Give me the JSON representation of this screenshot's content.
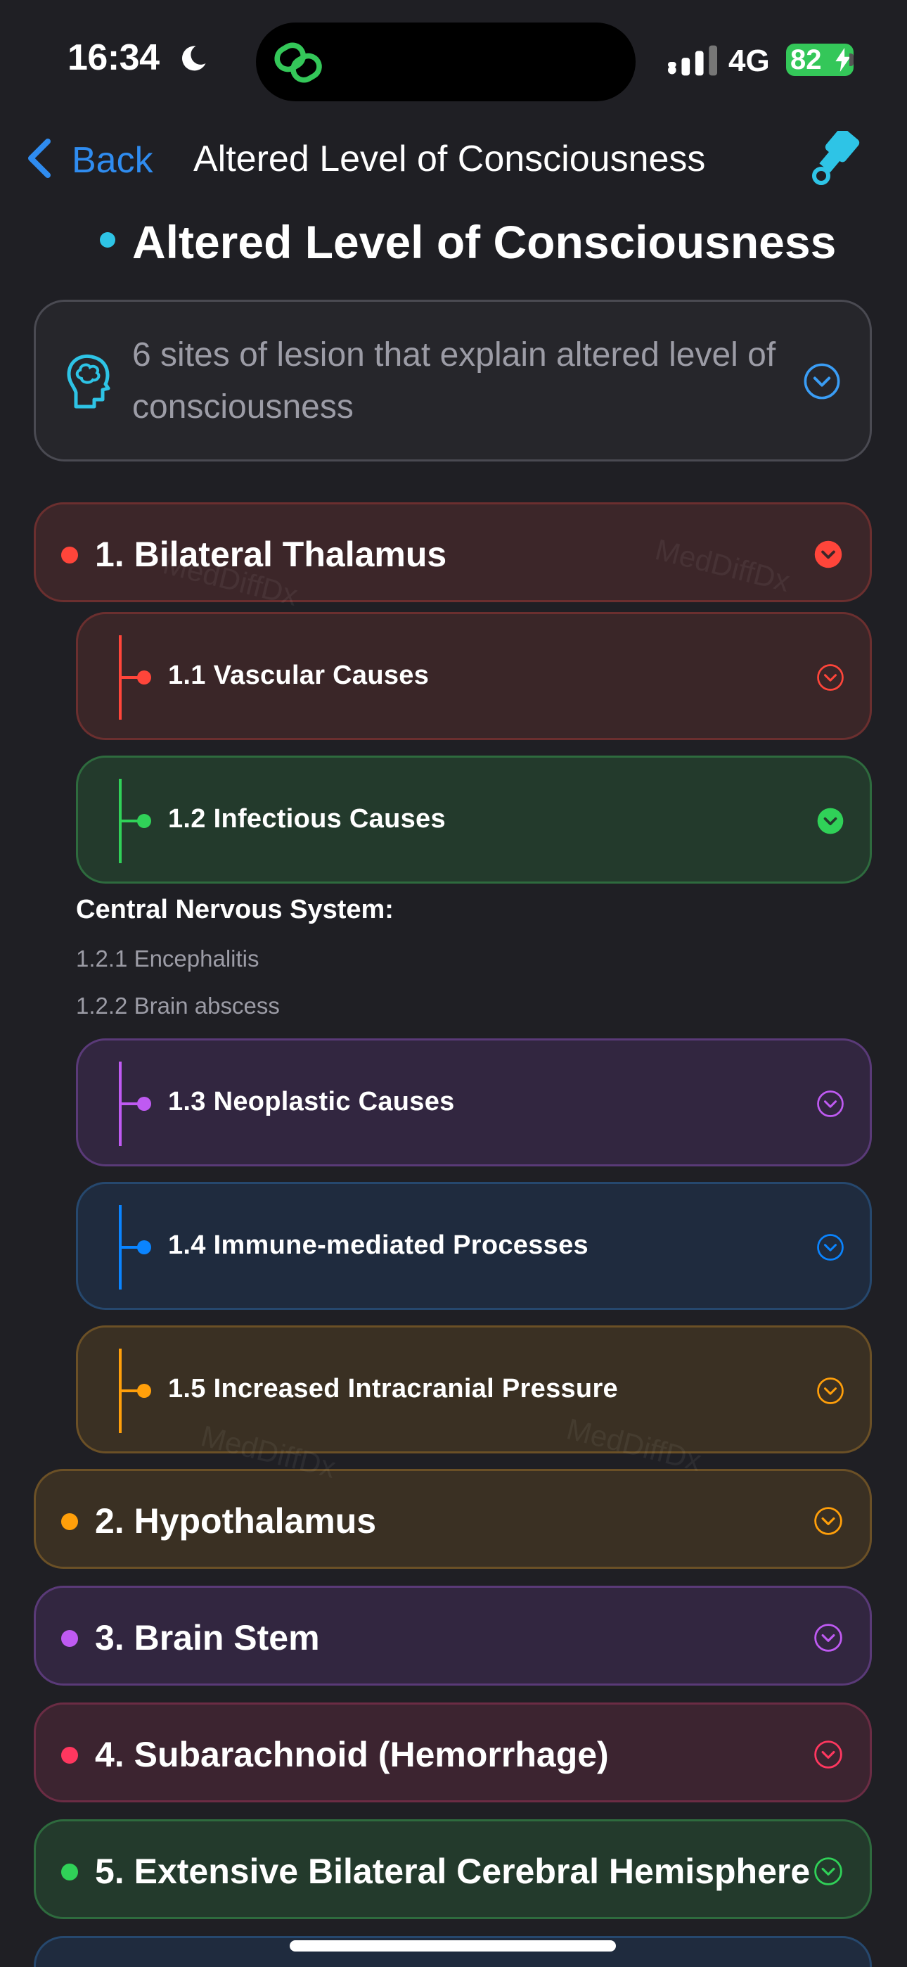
{
  "status_bar": {
    "time": "16:34",
    "network": "4G",
    "battery": "82"
  },
  "nav": {
    "back_label": "Back",
    "title": "Altered Level of Consciousness"
  },
  "page": {
    "title": "Altered Level of Consciousness"
  },
  "info_card": {
    "text": "6 sites of lesion that explain altered level of consciousness"
  },
  "sections": [
    {
      "label": "1. Bilateral Thalamus",
      "color": "#ff453a",
      "expanded": true
    },
    {
      "label": "2. Hypothalamus",
      "color": "#ff9f0a",
      "expanded": false
    },
    {
      "label": "3. Brain Stem",
      "color": "#bf5af2",
      "expanded": false
    },
    {
      "label": "4. Subarachnoid (Hemorrhage)",
      "color": "#ff375f",
      "expanded": false
    },
    {
      "label": "5. Extensive Bilateral Cerebral Hemisphere",
      "color": "#30d158",
      "expanded": false
    }
  ],
  "subsections": [
    {
      "label": "1.1 Vascular Causes",
      "color": "#ff453a",
      "expanded": false
    },
    {
      "label": "1.2 Infectious Causes",
      "color": "#30d158",
      "expanded": true
    },
    {
      "label": "1.3 Neoplastic Causes",
      "color": "#bf5af2",
      "expanded": false
    },
    {
      "label": "1.4 Immune-mediated Processes",
      "color": "#0a84ff",
      "expanded": false
    },
    {
      "label": "1.5 Increased Intracranial Pressure",
      "color": "#ff9f0a",
      "expanded": false
    }
  ],
  "infectious_detail": {
    "heading": "Central Nervous System:",
    "items": [
      "1.2.1 Encephalitis",
      "1.2.2 Brain abscess"
    ]
  },
  "watermark": "MedDiffDx"
}
